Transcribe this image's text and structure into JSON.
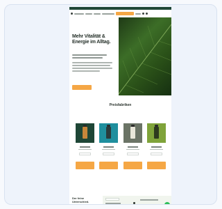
{
  "hero": {
    "headline": "Mehr Vitalität & Energie im Alltag.",
    "cta_label": ""
  },
  "section": {
    "eyebrow": "",
    "title": "Preisfabriken",
    "tabs": [
      "",
      "",
      "",
      ""
    ]
  },
  "products": [
    {
      "color": "#c7873a",
      "cta": ""
    },
    {
      "color": "#2c9fb0",
      "cta": ""
    },
    {
      "color": "#a5a48f",
      "cta": ""
    },
    {
      "color": "#7fa33a",
      "cta": ""
    }
  ],
  "footer": {
    "title": "Der feine Unterschied."
  },
  "colors": {
    "brand_dark": "#1e4636",
    "accent": "#f5a745",
    "chat": "#2fbf5a"
  }
}
